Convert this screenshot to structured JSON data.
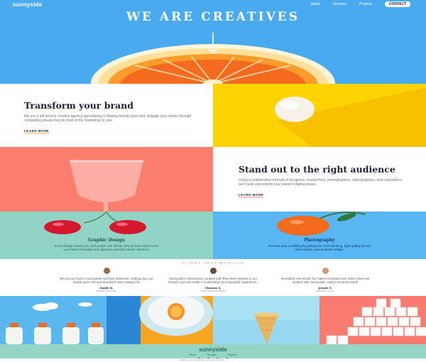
{
  "brand": {
    "logo": "sunnyside"
  },
  "nav": {
    "items": [
      "About",
      "Services",
      "Projects"
    ],
    "contact": "CONTACT"
  },
  "hero": {
    "title": "WE ARE CREATIVES"
  },
  "features": [
    {
      "title": "Transform your brand",
      "text": "We are a full-service creative agency specializing in helping brands grow fast. Engage your clients through compelling visuals that do most of the marketing for you.",
      "link": "LEARN MORE"
    },
    {
      "title": "Stand out to the right audience",
      "text": "Using a collaborative formula of designers, researchers, photographers, videographers, and copywriters, we'll build and extend your brand in digital places.",
      "link": "LEARN MORE"
    }
  ],
  "services": [
    {
      "title": "Graphic Design",
      "text": "Great design makes you memorable. We deliver artwork that underscores your brand message and captures potential clients' attention."
    },
    {
      "title": "Photography",
      "text": "Increase your credibility by getting the most stunning, high-quality photos that improve your business image."
    }
  ],
  "testimonials": {
    "heading": "CLIENT TESTIMONIALS",
    "items": [
      {
        "quote": "We put our trust in Sunnyside and they delivered, making sure our needs were met and deadlines were always hit.",
        "name": "Emily R.",
        "role": "Marketing Director"
      },
      {
        "quote": "Sunnyside's enthusiasm coupled with their keen interest in our brand's success made it a satisfying and enjoyable experience.",
        "name": "Thomas S.",
        "role": "Chief Operating Officer"
      },
      {
        "quote": "Incredible end result! Our sales increased over 400% when we worked with Sunnyside. Highly recommended!",
        "name": "Jennie F.",
        "role": "Business Owner"
      }
    ]
  },
  "footer": {
    "logo": "sunnyside",
    "nav": [
      "About",
      "Services",
      "Projects"
    ],
    "credit": "Challenge by Frontend Mentor. Coded by Jamie."
  },
  "colors": {
    "hero_blue": "#4aaaf0",
    "yellow": "#fdd302",
    "salmon": "#fb7d6e",
    "mint": "#90d4c5",
    "sky": "#5ab6f2",
    "footer_green": "#94d5c3"
  }
}
